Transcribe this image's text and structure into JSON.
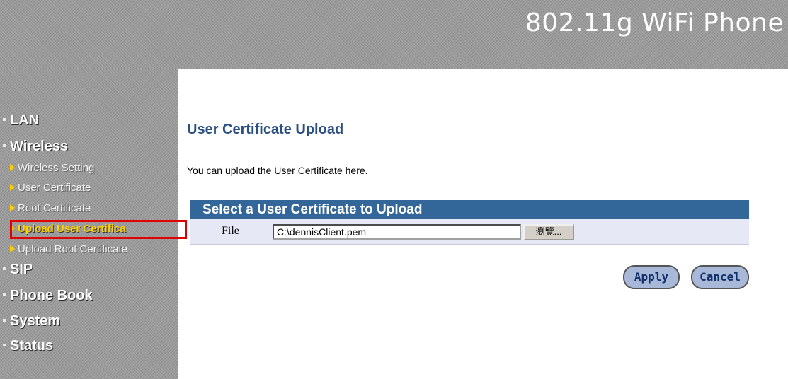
{
  "header": {
    "title": "802.11g WiFi Phone"
  },
  "sidebar": {
    "sections": [
      {
        "label": "LAN"
      },
      {
        "label": "Wireless"
      },
      {
        "label": "SIP"
      },
      {
        "label": "Phone Book"
      },
      {
        "label": "System"
      },
      {
        "label": "Status"
      }
    ],
    "wireless_items": [
      {
        "label": "Wireless Setting"
      },
      {
        "label": "User Certificate"
      },
      {
        "label": "Root Certificate"
      },
      {
        "label": "Upload User Certifica",
        "active": true
      },
      {
        "label": "Upload Root Certificate"
      }
    ]
  },
  "main": {
    "title": "User Certificate Upload",
    "intro": "You can upload the User Certificate here.",
    "form": {
      "header": "Select a User Certificate to Upload",
      "file_label": "File",
      "file_value": "C:\\dennisClient.pem",
      "browse_label": "瀏覽..."
    },
    "buttons": {
      "apply": "Apply",
      "cancel": "Cancel"
    }
  },
  "colors": {
    "accent_blue": "#336699",
    "title_blue": "#2a4f82",
    "active_nav": "#ffd200",
    "highlight_border": "#e00000"
  }
}
